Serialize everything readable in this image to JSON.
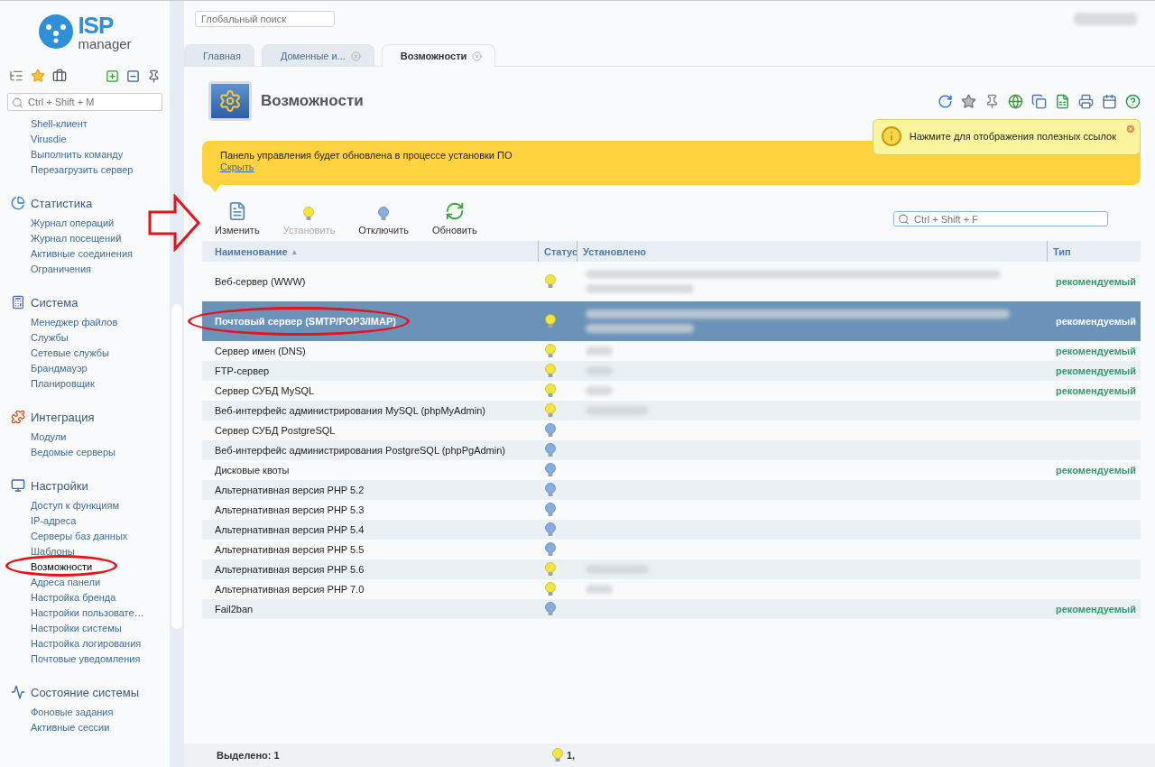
{
  "logo": {
    "mark": "ISP",
    "sub": "manager"
  },
  "sidebar": {
    "search": {
      "placeholder": "Ctrl + Shift + M"
    },
    "groups": [
      {
        "items": [
          {
            "label": "Shell-клиент",
            "selected": false,
            "circled": false
          },
          {
            "label": "Virusdie",
            "selected": false,
            "circled": false
          },
          {
            "label": "Выполнить команду",
            "selected": false,
            "circled": false
          },
          {
            "label": "Перезагрузить сервер",
            "selected": false,
            "circled": false
          }
        ]
      },
      {
        "title": "Статистика",
        "items": [
          {
            "label": "Журнал операций",
            "selected": false,
            "circled": false
          },
          {
            "label": "Журнал посещений",
            "selected": false,
            "circled": false
          },
          {
            "label": "Активные соединения",
            "selected": false,
            "circled": false
          },
          {
            "label": "Ограничения",
            "selected": false,
            "circled": false
          }
        ]
      },
      {
        "title": "Система",
        "items": [
          {
            "label": "Менеджер файлов",
            "selected": false,
            "circled": false
          },
          {
            "label": "Службы",
            "selected": false,
            "circled": false
          },
          {
            "label": "Сетевые службы",
            "selected": false,
            "circled": false
          },
          {
            "label": "Брандмауэр",
            "selected": false,
            "circled": false
          },
          {
            "label": "Планировщик",
            "selected": false,
            "circled": false
          }
        ]
      },
      {
        "title": "Интеграция",
        "items": [
          {
            "label": "Модули",
            "selected": false,
            "circled": false
          },
          {
            "label": "Ведомые серверы",
            "selected": false,
            "circled": false
          }
        ]
      },
      {
        "title": "Настройки",
        "items": [
          {
            "label": "Доступ к функциям",
            "selected": false,
            "circled": false
          },
          {
            "label": "IP-адреса",
            "selected": false,
            "circled": false
          },
          {
            "label": "Серверы баз данных",
            "selected": false,
            "circled": false
          },
          {
            "label": "Шаблоны",
            "selected": false,
            "circled": false
          },
          {
            "label": "Возможности",
            "selected": true,
            "circled": true
          },
          {
            "label": "Адреса панели",
            "selected": false,
            "circled": false
          },
          {
            "label": "Настройка бренда",
            "selected": false,
            "circled": false
          },
          {
            "label": "Настройки пользовате…",
            "selected": false,
            "circled": false
          },
          {
            "label": "Настройки системы",
            "selected": false,
            "circled": false
          },
          {
            "label": "Настройка логирования",
            "selected": false,
            "circled": false
          },
          {
            "label": "Почтовые уведомления",
            "selected": false,
            "circled": false
          }
        ]
      },
      {
        "title": "Состояние системы",
        "items": [
          {
            "label": "Фоновые задания",
            "selected": false,
            "circled": false
          },
          {
            "label": "Активные сессии",
            "selected": false,
            "circled": false
          }
        ]
      }
    ]
  },
  "global_search": {
    "placeholder": "Глобальный поиск"
  },
  "tabs": [
    {
      "label": "Главная",
      "selected": false,
      "closable": false
    },
    {
      "label": "Доменные и...",
      "selected": false,
      "closable": true
    },
    {
      "label": "Возможности",
      "selected": true,
      "closable": true
    }
  ],
  "page_title": "Возможности",
  "tooltip": "Нажмите для отображения полезных ссылок",
  "banner": {
    "text": "Панель управления будет обновлена в процессе установки ПО",
    "link": "Скрыть"
  },
  "toolbar": [
    {
      "label": "Изменить",
      "kind": "edit",
      "disabled": false,
      "pointed": true
    },
    {
      "label": "Установить",
      "kind": "install",
      "disabled": true,
      "pointed": false
    },
    {
      "label": "Отключить",
      "kind": "disable",
      "disabled": false,
      "pointed": false
    },
    {
      "label": "Обновить",
      "kind": "refresh",
      "disabled": false,
      "pointed": false
    }
  ],
  "filter": {
    "placeholder": "Ctrl + Shift + F"
  },
  "table": {
    "columns": [
      {
        "label": "Наименование",
        "sort": "▴"
      },
      {
        "label": "Статус"
      },
      {
        "label": "Установлено"
      },
      {
        "label": "Тип"
      }
    ],
    "rows": [
      {
        "name": "Веб-сервер (WWW)",
        "kind": "tall",
        "enabled": true,
        "installed_shown": true,
        "type": "рекомендуемый",
        "selected": false,
        "circled": false
      },
      {
        "name": "Почтовый сервер (SMTP/POP3/IMAP)",
        "kind": "tall",
        "enabled": true,
        "installed_shown": true,
        "type": "рекомендуемый",
        "selected": true,
        "circled": true
      },
      {
        "name": "Сервер имен (DNS)",
        "kind": "plain",
        "enabled": true,
        "installed_shown": true,
        "type": "рекомендуемый",
        "selected": false,
        "circled": false
      },
      {
        "name": "FTP-сервер",
        "kind": "plain",
        "enabled": true,
        "installed_shown": true,
        "type": "рекомендуемый",
        "selected": false,
        "circled": false
      },
      {
        "name": "Сервер СУБД MySQL",
        "kind": "plain",
        "enabled": true,
        "installed_shown": true,
        "type": "рекомендуемый",
        "selected": false,
        "circled": false
      },
      {
        "name": "Веб-интерфейс администрирования MySQL (phpMyAdmin)",
        "kind": "plain",
        "enabled": true,
        "installed_shown": true,
        "selected": false,
        "circled": false
      },
      {
        "name": "Сервер СУБД PostgreSQL",
        "kind": "plain",
        "enabled": false,
        "installed_shown": false,
        "selected": false,
        "circled": false
      },
      {
        "name": "Веб-интерфейс администрирования PostgreSQL (phpPgAdmin)",
        "kind": "plain",
        "enabled": false,
        "installed_shown": false,
        "selected": false,
        "circled": false
      },
      {
        "name": "Дисковые квоты",
        "kind": "plain",
        "enabled": false,
        "installed_shown": false,
        "type": "рекомендуемый",
        "selected": false,
        "circled": false
      },
      {
        "name": "Альтернативная версия PHP 5.2",
        "kind": "plain",
        "enabled": false,
        "installed_shown": false,
        "selected": false,
        "circled": false
      },
      {
        "name": "Альтернативная версия PHP 5.3",
        "kind": "plain",
        "enabled": false,
        "installed_shown": false,
        "selected": false,
        "circled": false
      },
      {
        "name": "Альтернативная версия PHP 5.4",
        "kind": "plain",
        "enabled": false,
        "installed_shown": false,
        "selected": false,
        "circled": false
      },
      {
        "name": "Альтернативная версия PHP 5.5",
        "kind": "plain",
        "enabled": false,
        "installed_shown": false,
        "selected": false,
        "circled": false
      },
      {
        "name": "Альтернативная версия PHP 5.6",
        "kind": "plain",
        "enabled": true,
        "installed_shown": true,
        "selected": false,
        "circled": false
      },
      {
        "name": "Альтернативная версия PHP 7.0",
        "kind": "plain",
        "enabled": true,
        "installed_shown": true,
        "selected": false,
        "circled": false
      },
      {
        "name": "Fail2ban",
        "kind": "plain",
        "enabled": false,
        "installed_shown": false,
        "type": "рекомендуемый",
        "selected": false,
        "circled": false
      }
    ]
  },
  "footer": {
    "selected_label": "Выделено: 1",
    "count": "1,"
  }
}
